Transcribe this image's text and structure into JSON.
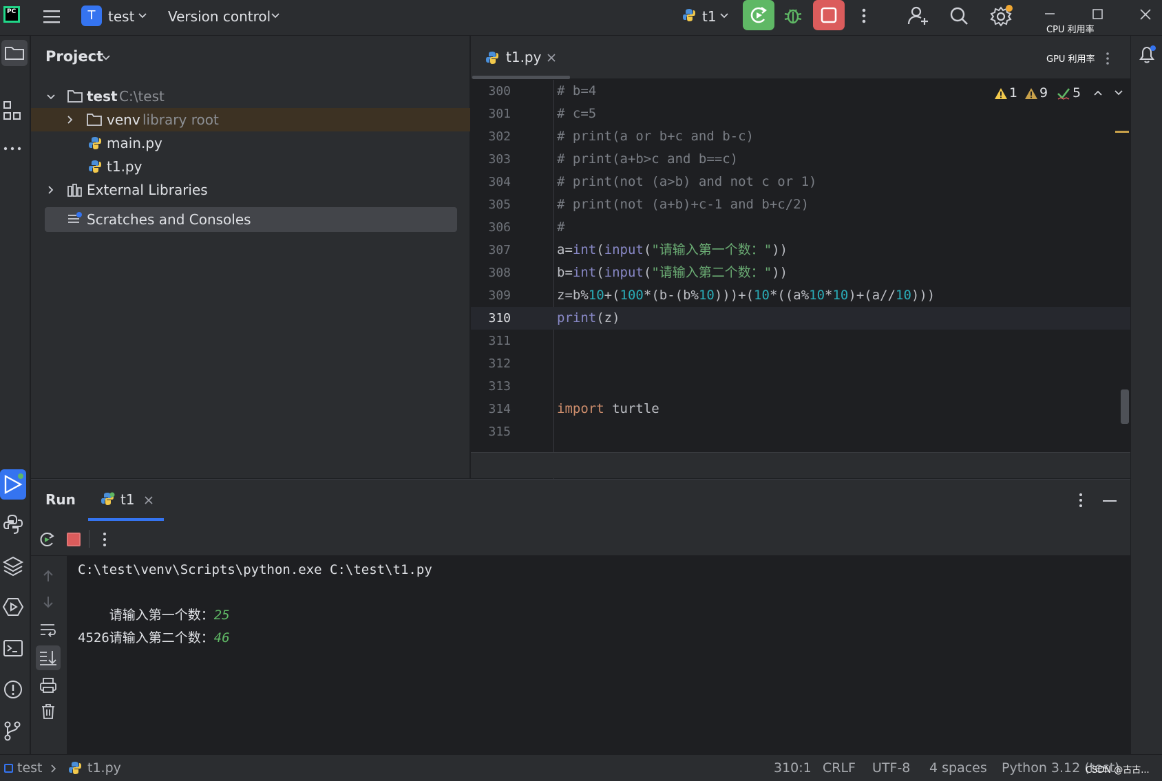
{
  "titlebar": {
    "project_letter": "T",
    "project_name": "test",
    "vcs_label": "Version control",
    "run_config": "t1",
    "cpu_label": "CPU 利用率",
    "gpu_label": "GPU 利用率"
  },
  "project_panel": {
    "title": "Project",
    "tree": {
      "root_name": "test",
      "root_path": "C:\\test",
      "venv_name": "venv",
      "venv_hint": "library root",
      "file1": "main.py",
      "file2": "t1.py",
      "external": "External Libraries",
      "scratches": "Scratches and Consoles"
    }
  },
  "editor": {
    "tab_label": "t1.py",
    "inspections": {
      "warnings_a": "1",
      "warnings_b": "9",
      "ok": "5"
    },
    "current_line": "310",
    "lines": [
      {
        "n": "300",
        "text": "# b=4"
      },
      {
        "n": "301",
        "text": "# c=5"
      },
      {
        "n": "302",
        "text": "# print(a or b+c and b-c)"
      },
      {
        "n": "303",
        "text": "# print(a+b>c and b==c)"
      },
      {
        "n": "304",
        "text": "# print(not (a>b) and not c or 1)"
      },
      {
        "n": "305",
        "text": "# print(not (a+b)+c-1 and b+c/2)"
      },
      {
        "n": "306",
        "text": "#"
      },
      {
        "n": "307",
        "text": "a=int(input(\"请输入第一个数：\"))"
      },
      {
        "n": "308",
        "text": "b=int(input(\"请输入第二个数：\"))"
      },
      {
        "n": "309",
        "text": "z=b%10+(100*(b-(b%10)))+(10*((a%10*10)+(a//10)))"
      },
      {
        "n": "310",
        "text": "print(z)"
      },
      {
        "n": "311",
        "text": ""
      },
      {
        "n": "312",
        "text": ""
      },
      {
        "n": "313",
        "text": ""
      },
      {
        "n": "314",
        "text": "import turtle"
      },
      {
        "n": "315",
        "text": ""
      }
    ]
  },
  "run_panel": {
    "title": "Run",
    "tab_label": "t1",
    "output": {
      "cmd": "C:\\test\\venv\\Scripts\\python.exe C:\\test\\t1.py",
      "prompt1": "请输入第一个数：",
      "input1": "25",
      "prompt2": "请输入第二个数：",
      "input2": "46",
      "result": "4526"
    }
  },
  "statusbar": {
    "crumb_project": "test",
    "crumb_file": "t1.py",
    "position": "310:1",
    "line_sep": "CRLF",
    "encoding": "UTF-8",
    "indent": "4 spaces",
    "interpreter": "Python 3.12 (test)",
    "watermark": "CSDN @古古..."
  },
  "colors": {
    "accent": "#3574f0",
    "run_green": "#5fb865",
    "stop_red": "#db5c5c",
    "comment": "#7a7e85",
    "string": "#6aab73",
    "number": "#2aacb8",
    "keyword": "#cf8e6d",
    "builtin": "#8888c6"
  }
}
